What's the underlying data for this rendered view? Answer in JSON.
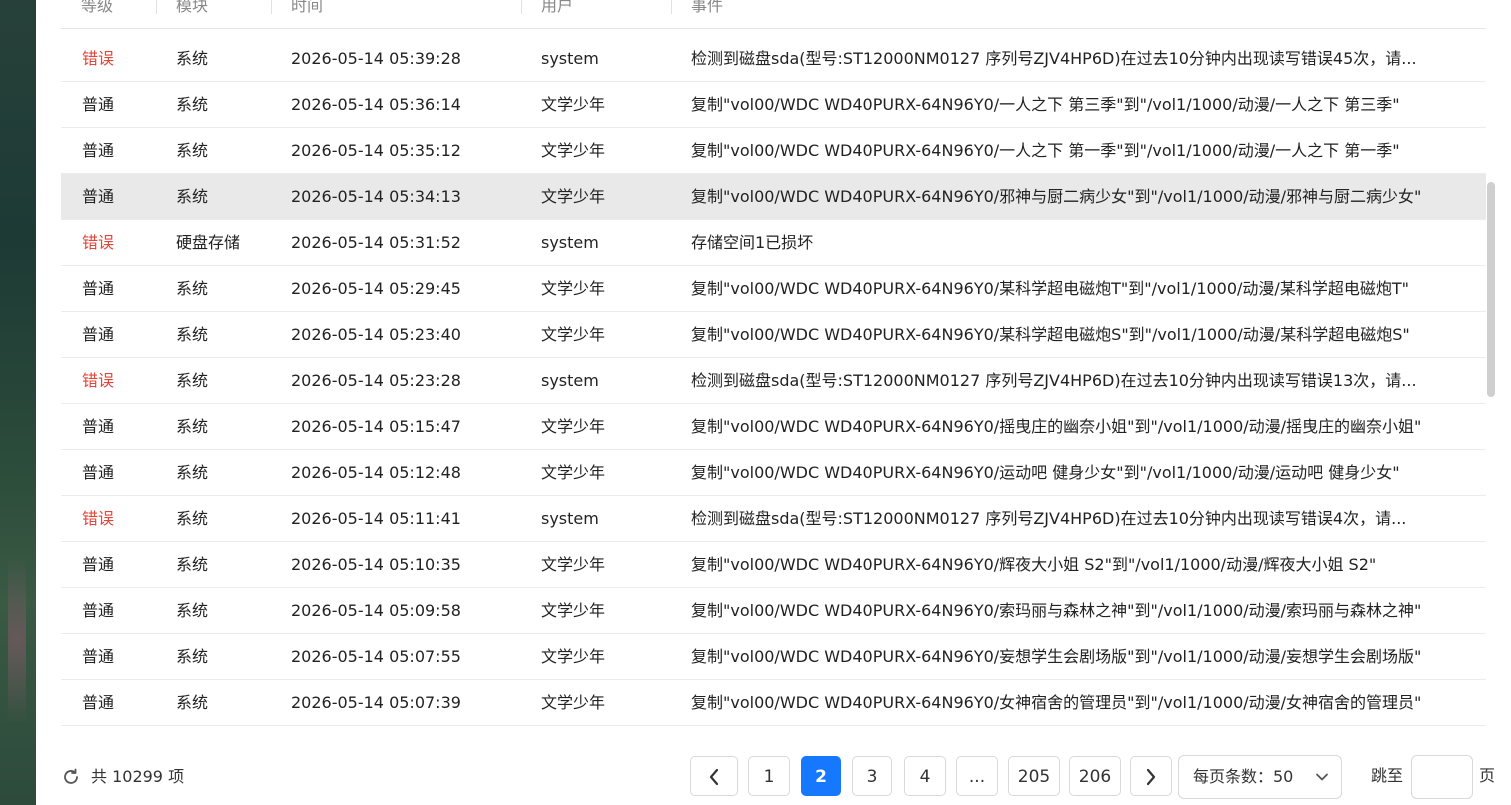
{
  "table": {
    "headers": {
      "level": "等级",
      "module": "模块",
      "time": "时间",
      "user": "用户",
      "event": "事件"
    },
    "rows": [
      {
        "level": "错误",
        "error": true,
        "module": "系统",
        "time": "2026-05-14 05:39:28",
        "user": "system",
        "event": "检测到磁盘sda(型号:ST12000NM0127 序列号ZJV4HP6D)在过去10分钟内出现读写错误45次，请..."
      },
      {
        "level": "普通",
        "error": false,
        "module": "系统",
        "time": "2026-05-14 05:36:14",
        "user": "文学少年",
        "event": "复制\"vol00/WDC WD40PURX-64N96Y0/一人之下 第三季\"到\"/vol1/1000/动漫/一人之下 第三季\""
      },
      {
        "level": "普通",
        "error": false,
        "module": "系统",
        "time": "2026-05-14 05:35:12",
        "user": "文学少年",
        "event": "复制\"vol00/WDC WD40PURX-64N96Y0/一人之下 第一季\"到\"/vol1/1000/动漫/一人之下 第一季\""
      },
      {
        "level": "普通",
        "error": false,
        "module": "系统",
        "time": "2026-05-14 05:34:13",
        "user": "文学少年",
        "event": "复制\"vol00/WDC WD40PURX-64N96Y0/邪神与厨二病少女\"到\"/vol1/1000/动漫/邪神与厨二病少女\"",
        "highlight": true
      },
      {
        "level": "错误",
        "error": true,
        "module": "硬盘存储",
        "time": "2026-05-14 05:31:52",
        "user": "system",
        "event": "存储空间1已损坏"
      },
      {
        "level": "普通",
        "error": false,
        "module": "系统",
        "time": "2026-05-14 05:29:45",
        "user": "文学少年",
        "event": "复制\"vol00/WDC WD40PURX-64N96Y0/某科学超电磁炮T\"到\"/vol1/1000/动漫/某科学超电磁炮T\""
      },
      {
        "level": "普通",
        "error": false,
        "module": "系统",
        "time": "2026-05-14 05:23:40",
        "user": "文学少年",
        "event": "复制\"vol00/WDC WD40PURX-64N96Y0/某科学超电磁炮S\"到\"/vol1/1000/动漫/某科学超电磁炮S\""
      },
      {
        "level": "错误",
        "error": true,
        "module": "系统",
        "time": "2026-05-14 05:23:28",
        "user": "system",
        "event": "检测到磁盘sda(型号:ST12000NM0127 序列号ZJV4HP6D)在过去10分钟内出现读写错误13次，请..."
      },
      {
        "level": "普通",
        "error": false,
        "module": "系统",
        "time": "2026-05-14 05:15:47",
        "user": "文学少年",
        "event": "复制\"vol00/WDC WD40PURX-64N96Y0/摇曳庄的幽奈小姐\"到\"/vol1/1000/动漫/摇曳庄的幽奈小姐\""
      },
      {
        "level": "普通",
        "error": false,
        "module": "系统",
        "time": "2026-05-14 05:12:48",
        "user": "文学少年",
        "event": "复制\"vol00/WDC WD40PURX-64N96Y0/运动吧 健身少女\"到\"/vol1/1000/动漫/运动吧 健身少女\""
      },
      {
        "level": "错误",
        "error": true,
        "module": "系统",
        "time": "2026-05-14 05:11:41",
        "user": "system",
        "event": "检测到磁盘sda(型号:ST12000NM0127 序列号ZJV4HP6D)在过去10分钟内出现读写错误4次，请..."
      },
      {
        "level": "普通",
        "error": false,
        "module": "系统",
        "time": "2026-05-14 05:10:35",
        "user": "文学少年",
        "event": "复制\"vol00/WDC WD40PURX-64N96Y0/辉夜大小姐 S2\"到\"/vol1/1000/动漫/辉夜大小姐 S2\""
      },
      {
        "level": "普通",
        "error": false,
        "module": "系统",
        "time": "2026-05-14 05:09:58",
        "user": "文学少年",
        "event": "复制\"vol00/WDC WD40PURX-64N96Y0/索玛丽与森林之神\"到\"/vol1/1000/动漫/索玛丽与森林之神\""
      },
      {
        "level": "普通",
        "error": false,
        "module": "系统",
        "time": "2026-05-14 05:07:55",
        "user": "文学少年",
        "event": "复制\"vol00/WDC WD40PURX-64N96Y0/妄想学生会剧场版\"到\"/vol1/1000/动漫/妄想学生会剧场版\""
      },
      {
        "level": "普通",
        "error": false,
        "module": "系统",
        "time": "2026-05-14 05:07:39",
        "user": "文学少年",
        "event": "复制\"vol00/WDC WD40PURX-64N96Y0/女神宿舍的管理员\"到\"/vol1/1000/动漫/女神宿舍的管理员\""
      }
    ]
  },
  "footer": {
    "total": "共 10299 项",
    "pages": [
      {
        "label": "1",
        "active": false
      },
      {
        "label": "2",
        "active": true
      },
      {
        "label": "3",
        "active": false
      },
      {
        "label": "4",
        "active": false
      },
      {
        "label": "...",
        "active": false
      },
      {
        "label": "205",
        "active": false
      },
      {
        "label": "206",
        "active": false
      }
    ],
    "page_size_label": "每页条数：50",
    "jump_label": "跳至",
    "jump_value": "",
    "page_unit": "页"
  },
  "colors": {
    "error": "#e0463b",
    "active_page": "#1677ff",
    "highlight_row": "#e9e9e9"
  }
}
